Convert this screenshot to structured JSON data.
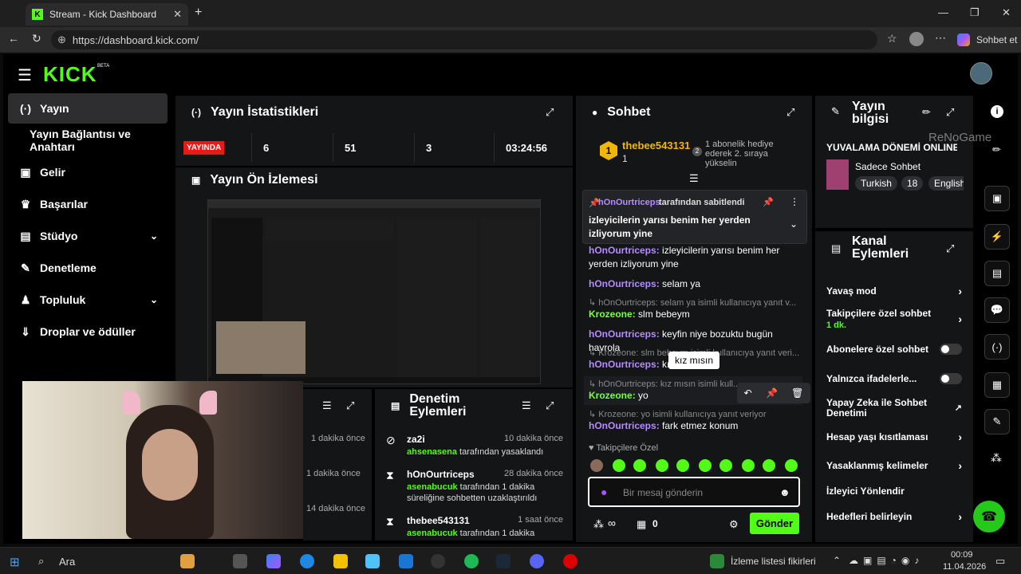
{
  "browser": {
    "tab_title": "Stream - Kick Dashboard",
    "url": "https://dashboard.kick.com/",
    "copilot_label": "Sohbet et"
  },
  "brand": {
    "logo": "KICK",
    "beta": "BETA",
    "accent": "#53fc18"
  },
  "sidebar": {
    "items": [
      {
        "label": "Yayın",
        "icon": "broadcast-icon"
      },
      {
        "label": "Yayın Bağlantısı ve Anahtarı",
        "icon": ""
      },
      {
        "label": "Gelir",
        "icon": "wallet-icon"
      },
      {
        "label": "Başarılar",
        "icon": "trophy-icon"
      },
      {
        "label": "Stüdyo",
        "icon": "studio-icon"
      },
      {
        "label": "Denetleme",
        "icon": "wrench-icon"
      },
      {
        "label": "Topluluk",
        "icon": "people-icon"
      },
      {
        "label": "Droplar ve ödüller",
        "icon": "drops-icon"
      }
    ]
  },
  "stats": {
    "title": "Yayın İstatistikleri",
    "live_badge": "YAYINDA",
    "values": [
      "6",
      "51",
      "3",
      "03:24:56"
    ]
  },
  "preview": {
    "title": "Yayın Ön İzlemesi"
  },
  "chat": {
    "title": "Sohbet",
    "top_user": "thebee543131",
    "top_count": "1",
    "gift_text": "1 abonelik hediye ederek 2. sıraya yükselin",
    "pinned_by_user": "hOnOurtriceps",
    "pinned_by_suffix": "tarafından sabitlendi",
    "pinned_text": "izleyicilerin yarısı benim her yerden izliyorum yine",
    "messages": [
      {
        "user": "hOnOurtriceps",
        "text": "izleyicilerin yarısı benim her yerden izliyorum yine"
      },
      {
        "user": "hOnOurtriceps",
        "text": "selam ya"
      },
      {
        "reply": "hOnOurtriceps: selam ya isimli kullanıcıya yanıt v...",
        "user": "Krozeone",
        "text": "slm bebeym"
      },
      {
        "user": "hOnOurtriceps",
        "text": "keyfin niye bozuktu bugün hayrola"
      },
      {
        "reply": "Krozeone: slm bebeym isimli kullanıcıya yanıt veri...",
        "user": "hOnOurtriceps",
        "text": "kız mısın"
      },
      {
        "reply": "hOnOurtriceps: kız mısın isimli kull...",
        "user": "Krozeone",
        "text": "yo"
      },
      {
        "reply": "Krozeone: yo isimli kullanıcıya yanıt veriyor",
        "user": "hOnOurtriceps",
        "text": "fark etmez konum"
      }
    ],
    "tooltip": "kız mısın",
    "followers_only": "Takipçilere Özel",
    "input_placeholder": "Bir mesaj gönderin",
    "points": "∞",
    "gift_count": "0",
    "send_label": "Gönder"
  },
  "stream_info": {
    "title": "Yayın bilgisi",
    "stream_title": "YUVALAMA DÖNEMİ ONLINE",
    "category": "Sadece Sohbet",
    "tags": [
      "Turkish",
      "18",
      "English"
    ],
    "watermark": "ReNoGame"
  },
  "channel_actions": {
    "title": "Kanal Eylemleri",
    "items": [
      {
        "label": "Yavaş mod",
        "type": "chevron"
      },
      {
        "label": "Takipçilere özel sohbet",
        "sub": "1 dk.",
        "type": "chevron"
      },
      {
        "label": "Abonelere özel sohbet",
        "type": "toggle"
      },
      {
        "label": "Yalnızca ifadelerle...",
        "type": "toggle"
      },
      {
        "label": "Yapay Zeka ile Sohbet Denetimi",
        "type": "external"
      },
      {
        "label": "Hesap yaşı kısıtlaması",
        "type": "chevron"
      },
      {
        "label": "Yasaklanmış kelimeler",
        "type": "chevron"
      },
      {
        "label": "İzleyici Yönlendir",
        "type": "none"
      },
      {
        "label": "Hedefleri belirleyin",
        "type": "chevron"
      }
    ]
  },
  "activity": {
    "times": [
      "1 dakika önce",
      "1 dakika önce",
      "14 dakika önce"
    ]
  },
  "moderation": {
    "title": "Denetim Eylemleri",
    "items": [
      {
        "user": "za2i",
        "time": "10 dakika önce",
        "actor": "ahsenasena",
        "desc": "tarafından yasaklandı",
        "icon": "ban-icon"
      },
      {
        "user": "hOnOurtriceps",
        "time": "28 dakika önce",
        "actor": "asenabucuk",
        "desc": "tarafından 1 dakika süreliğine sohbetten uzaklaştırıldı",
        "icon": "hourglass-icon"
      },
      {
        "user": "thebee543131",
        "time": "1 saat önce",
        "actor": "asenabucuk",
        "desc": "tarafından 1 dakika",
        "icon": "hourglass-icon"
      }
    ]
  },
  "taskbar": {
    "search": "Ara",
    "news": "İzleme listesi fikirleri",
    "time": "00:09",
    "date": "11.04.2026"
  }
}
